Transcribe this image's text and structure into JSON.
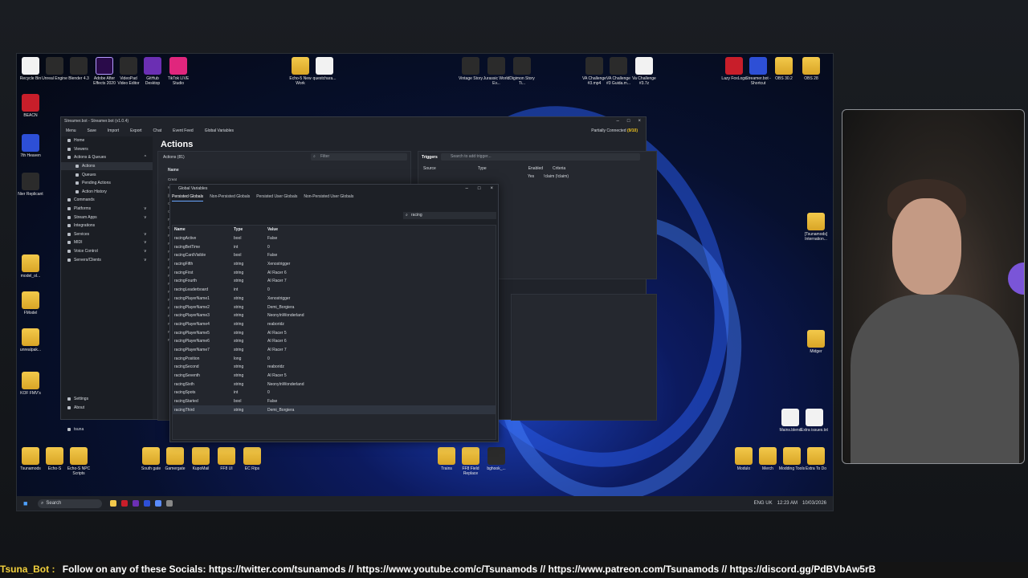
{
  "desktop": {
    "top_icons": [
      {
        "label": "Recycle Bin",
        "glyph": "file"
      },
      {
        "label": "Unreal Engine",
        "glyph": "dark"
      },
      {
        "label": "Blender 4.3",
        "glyph": "dark"
      },
      {
        "label": "Adobe After Effects 2020",
        "glyph": "ae"
      },
      {
        "label": "VideoPad Video Editor",
        "glyph": "dark"
      },
      {
        "label": "GitHub Desktop",
        "glyph": "purple"
      },
      {
        "label": "TikTok LIVE Studio",
        "glyph": "pink"
      },
      {
        "label": "Echo-5 New Work",
        "glyph": "folder"
      },
      {
        "label": "questchara...",
        "glyph": "file"
      },
      {
        "label": "Vintage Story",
        "glyph": "dark"
      },
      {
        "label": "Jurassic World Ev...",
        "glyph": "dark"
      },
      {
        "label": "Digimon Story Ti...",
        "glyph": "dark"
      },
      {
        "label": "VA Challenge #3.mp4",
        "glyph": "dark"
      },
      {
        "label": "VA Challenge #3 Guida.m...",
        "glyph": "dark"
      },
      {
        "label": "Va Challenge #3.7z",
        "glyph": "file"
      },
      {
        "label": "Lazy FoxLogs",
        "glyph": "red"
      },
      {
        "label": "Streamer.bot - Shortcut",
        "glyph": "blue"
      },
      {
        "label": "OBS 30.2",
        "glyph": "folder"
      },
      {
        "label": "OBS 28",
        "glyph": "folder"
      }
    ],
    "left_icons": [
      {
        "label": "BEACN",
        "glyph": "red"
      },
      {
        "label": "7th Heaven",
        "glyph": "blue"
      },
      {
        "label": "Nier Replicant",
        "glyph": "dark"
      },
      {
        "label": "model_ol...",
        "glyph": "folder"
      },
      {
        "label": "FModel",
        "glyph": "folder"
      },
      {
        "label": "unrealpak...",
        "glyph": "folder"
      },
      {
        "label": "KOF FMV's",
        "glyph": "folder"
      }
    ],
    "bottom_icons": [
      {
        "label": "Tsunamods",
        "glyph": "folder"
      },
      {
        "label": "Echo-S",
        "glyph": "folder"
      },
      {
        "label": "Echo-S NPC Scripts",
        "glyph": "folder"
      },
      {
        "label": "South gate",
        "glyph": "folder"
      },
      {
        "label": "Gamergate",
        "glyph": "folder"
      },
      {
        "label": "KupoMail",
        "glyph": "folder"
      },
      {
        "label": "FF8 UI",
        "glyph": "folder"
      },
      {
        "label": "EC Rips",
        "glyph": "folder"
      },
      {
        "label": "Trains",
        "glyph": "folder"
      },
      {
        "label": "FF8 Field Replace",
        "glyph": "folder"
      },
      {
        "label": "bghook_...",
        "glyph": "dark"
      },
      {
        "label": "Modulo",
        "glyph": "folder"
      },
      {
        "label": "Merch",
        "glyph": "folder"
      },
      {
        "label": "Modding Tools",
        "glyph": "folder"
      },
      {
        "label": "Extra To Do",
        "glyph": "folder"
      }
    ],
    "right_icons": [
      {
        "label": "[Tsunamods] Internation...",
        "glyph": "folder"
      },
      {
        "label": "Midger",
        "glyph": "folder"
      },
      {
        "label": "Mains.blend",
        "glyph": "file"
      },
      {
        "label": "Extra issues.txt",
        "glyph": "file"
      }
    ]
  },
  "taskbar": {
    "search_placeholder": "Search",
    "tray_lang": "ENG UK",
    "time": "12:23 AM",
    "date": "10/03/2026"
  },
  "streamerbot": {
    "title": "Streamer.bot - Streamer.bot (v1.0.4)",
    "menu": [
      "Menu",
      "Save",
      "Import",
      "Export",
      "Chat",
      "Event Feed",
      "Global Variables"
    ],
    "status_prefix": "Partially Connected",
    "status_count": "(9/10)",
    "nav": [
      {
        "label": "Home",
        "sub": false,
        "active": false,
        "chev": ""
      },
      {
        "label": "Viewers",
        "sub": false,
        "active": false,
        "chev": ""
      },
      {
        "label": "Actions & Queues",
        "sub": false,
        "active": false,
        "chev": "^"
      },
      {
        "label": "Actions",
        "sub": true,
        "active": true,
        "chev": ""
      },
      {
        "label": "Queues",
        "sub": true,
        "active": false,
        "chev": ""
      },
      {
        "label": "Pending Actions",
        "sub": true,
        "active": false,
        "chev": ""
      },
      {
        "label": "Action History",
        "sub": true,
        "active": false,
        "chev": ""
      },
      {
        "label": "Commands",
        "sub": false,
        "active": false,
        "chev": ""
      },
      {
        "label": "Platforms",
        "sub": false,
        "active": false,
        "chev": "v"
      },
      {
        "label": "Stream Apps",
        "sub": false,
        "active": false,
        "chev": "v"
      },
      {
        "label": "Integrations",
        "sub": false,
        "active": false,
        "chev": ""
      },
      {
        "label": "Services",
        "sub": false,
        "active": false,
        "chev": "v"
      },
      {
        "label": "MIDI",
        "sub": false,
        "active": false,
        "chev": "v"
      },
      {
        "label": "Voice Control",
        "sub": false,
        "active": false,
        "chev": "v"
      },
      {
        "label": "Servers/Clients",
        "sub": false,
        "active": false,
        "chev": "v"
      }
    ],
    "nav_bottom": [
      {
        "label": "Settings"
      },
      {
        "label": "About"
      }
    ],
    "user": "tsuna",
    "page_title": "Actions",
    "actions_label": "Actions (81)",
    "filter_placeholder": "Filter",
    "triggers_label": "Triggers",
    "triggers_search": "Search to add trigger...",
    "triggers_cols": [
      "Source",
      "Type",
      "Enabled",
      "Criteria"
    ],
    "trigger_row": {
      "enabled": "Yes",
      "criteria": "!claim (!claim)"
    },
    "actions_col": "Name",
    "actions_rows": [
      "Creat",
      "!Comm",
      "[Heist]",
      "Chocol",
      "Chocol",
      "Featur",
      "Games",
      "Racing",
      "Racing",
      "Racing",
      "Racing",
      "Racing",
      "Racing",
      "Racing",
      "Racing",
      "Racing",
      "Racing",
      "Racing",
      "Racing",
      "Racing",
      "Racing"
    ]
  },
  "globals": {
    "title": "Global Variables",
    "tabs": [
      "Persisted Globals",
      "Non-Persisted Globals",
      "Persisted User Globals",
      "Non-Persisted User Globals"
    ],
    "search_value": "racing",
    "columns": {
      "name": "Name",
      "type": "Type",
      "value": "Value"
    },
    "rows": [
      {
        "name": "racingActive",
        "type": "bool",
        "value": "False"
      },
      {
        "name": "racingBetTime",
        "type": "int",
        "value": "0"
      },
      {
        "name": "racingCardVisible",
        "type": "bool",
        "value": "False"
      },
      {
        "name": "racingFifth",
        "type": "string",
        "value": "Xenostrigger"
      },
      {
        "name": "racingFirst",
        "type": "string",
        "value": "AI Racer 6"
      },
      {
        "name": "racingFourth",
        "type": "string",
        "value": "AI Racer 7"
      },
      {
        "name": "racingLeaderboard",
        "type": "int",
        "value": "0"
      },
      {
        "name": "racingPlayerName1",
        "type": "string",
        "value": "Xenostrigger"
      },
      {
        "name": "racingPlayerName2",
        "type": "string",
        "value": "Demi_Borgiera"
      },
      {
        "name": "racingPlayerName3",
        "type": "string",
        "value": "NeonyInWonderland"
      },
      {
        "name": "racingPlayerName4",
        "type": "string",
        "value": "reaboridz"
      },
      {
        "name": "racingPlayerName5",
        "type": "string",
        "value": "AI Racer 5"
      },
      {
        "name": "racingPlayerName6",
        "type": "string",
        "value": "AI Racer 6"
      },
      {
        "name": "racingPlayerName7",
        "type": "string",
        "value": "AI Racer 7"
      },
      {
        "name": "racingPosition",
        "type": "long",
        "value": "0"
      },
      {
        "name": "racingSecond",
        "type": "string",
        "value": "reaboridz"
      },
      {
        "name": "racingSeventh",
        "type": "string",
        "value": "AI Racer 5"
      },
      {
        "name": "racingSixth",
        "type": "string",
        "value": "NeonyInWonderland"
      },
      {
        "name": "racingSpots",
        "type": "int",
        "value": "0"
      },
      {
        "name": "racingStarted",
        "type": "bool",
        "value": "False"
      },
      {
        "name": "racingThird",
        "type": "string",
        "value": "Demi_Borgiera"
      }
    ]
  },
  "ticker": {
    "bot": "Tsuna_Bot :",
    "message": "Follow on any of these Socials: https://twitter.com/tsunamods // https://www.youtube.com/c/Tsunamods // https://www.patreon.com/Tsunamods // https://discord.gg/PdBVbAw5rB"
  },
  "colors": {
    "accent": "#6aa6ff",
    "status_warn": "#f0c420",
    "ticker_bot": "#f4d23d"
  }
}
